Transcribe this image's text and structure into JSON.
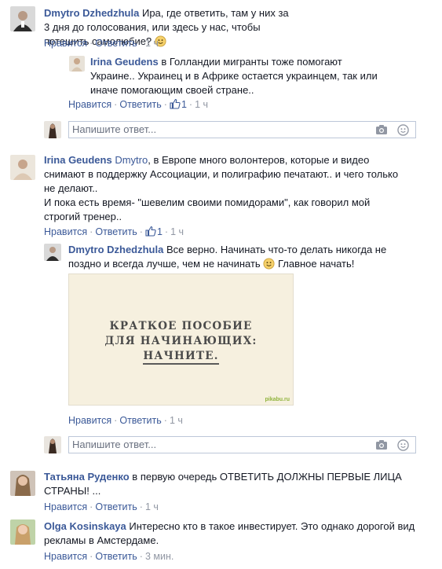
{
  "labels": {
    "like": "Нравится",
    "reply": "Ответить",
    "reply_placeholder": "Напишите ответ..."
  },
  "comments": [
    {
      "author": "Dmytro Dzhedzhula",
      "text": "Ира, где ответить, там у них за 3 дня до голосования, или здесь у нас, чтобы потешить самолюбие?",
      "time": "1 ч",
      "replies": [
        {
          "author": "Irina Geudens",
          "text": "в Голландии мигранты тоже помогают Украине.. Украинец и в Африке остается украинцем, так или иначе помогающим своей стране..",
          "likes": "1",
          "time": "1 ч"
        }
      ]
    },
    {
      "author": "Irina Geudens",
      "mention": "Dmytro",
      "text": ", в Европе много волонтеров, которые и видео снимают в поддержку Ассоциации, и полиграфию печатают.. и чего только не делают..",
      "text2": "И пока есть время- \"шевелим своими помидорами\", как говорил мой строгий тренер..",
      "likes": "1",
      "time": "1 ч",
      "replies": [
        {
          "author": "Dmytro Dzhedzhula",
          "text": "Все верно. Начинать что-то делать никогда не поздно и всегда лучше, чем не начинать",
          "text_after": "Главное начать!",
          "image": {
            "line1": "КРАТКОЕ ПОСОБИЕ",
            "line2": "ДЛЯ НАЧИНАЮЩИХ:",
            "line3": "НАЧНИТЕ.",
            "watermark": "pikabu.ru"
          },
          "time": "1 ч"
        }
      ]
    },
    {
      "author": "Татьяна Руденко",
      "text": "в первую очередь ОТВЕТИТЬ ДОЛЖНЫ ПЕРВЫЕ ЛИЦА СТРАНЫ! ...",
      "time": "1 ч"
    },
    {
      "author": "Olga Kosinskaya",
      "text": "Интересно кто в такое инвестирует. Это однако дорогой вид рекламы в Амстердаме.",
      "time": "3 мин."
    }
  ],
  "colors": {
    "link": "#3b5998",
    "meta": "#9197a3",
    "border": "#bdc7d8"
  }
}
